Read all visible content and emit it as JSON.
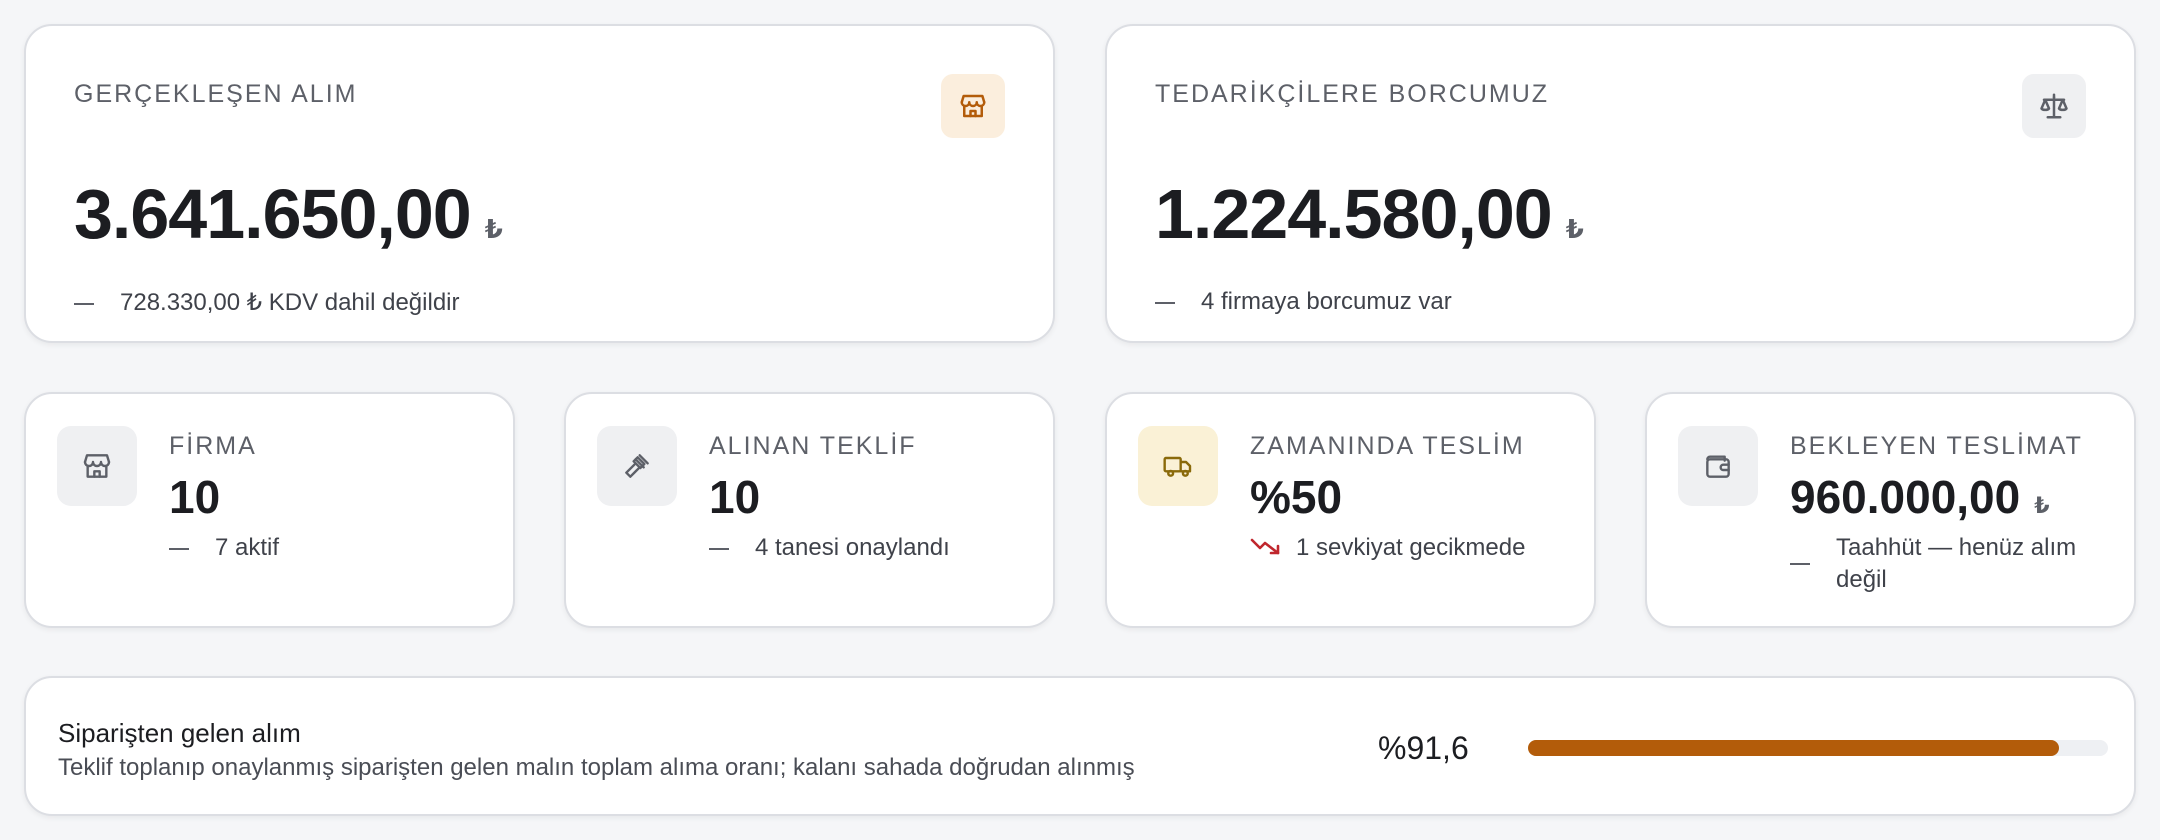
{
  "colors": {
    "accent": "#b35c0a",
    "orange_soft": "#fbeedd",
    "yellow_soft": "#faf1d6",
    "gray_soft": "#eff0f2",
    "danger": "#c0262d"
  },
  "purchase_card": {
    "label": "GERÇEKLEŞEN ALIM",
    "icon": "store-icon",
    "value": "3.641.650,00",
    "currency": "₺",
    "sub": "728.330,00 ₺ KDV dahil değildir"
  },
  "debt_card": {
    "label": "TEDARİKÇİLERE BORCUMUZ",
    "icon": "scale-icon",
    "value": "1.224.580,00",
    "currency": "₺",
    "sub": "4 firmaya borcumuz var"
  },
  "stats": [
    {
      "label": "FİRMA",
      "icon": "store-icon",
      "value": "10",
      "sub": "7 aktif"
    },
    {
      "label": "ALINAN TEKLİF",
      "icon": "gavel-icon",
      "value": "10",
      "sub": "4 tanesi onaylandı"
    },
    {
      "label": "ZAMANINDA TESLİM",
      "icon": "truck-icon",
      "value": "%50",
      "sub": "1 sevkiyat gecikmede",
      "trend": "down"
    },
    {
      "label": "BEKLEYEN TESLİMAT",
      "icon": "wallet-icon",
      "value": "960.000,00",
      "currency": "₺",
      "sub": "Taahhüt — henüz alım değil"
    }
  ],
  "order_share": {
    "title": "Siparişten gelen alım",
    "description": "Teklif toplanıp onaylanmış siparişten gelen malın toplam alıma oranı; kalanı sahada doğrudan alınmış",
    "percent_label": "%91,6",
    "percent": 91.6
  }
}
